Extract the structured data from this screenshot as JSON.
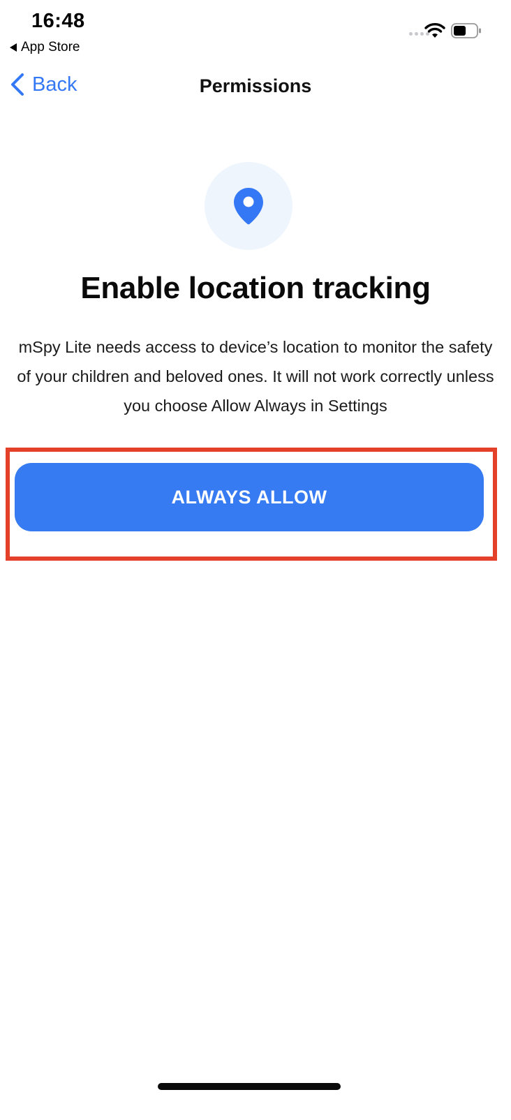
{
  "status_bar": {
    "time": "16:48",
    "back_app_label": "App Store",
    "icons": [
      "cellular-signal-icon",
      "wifi-icon",
      "battery-icon"
    ]
  },
  "nav": {
    "back_label": "Back",
    "title": "Permissions"
  },
  "content": {
    "icon": "location-pin-icon",
    "heading": "Enable location tracking",
    "description": "mSpy Lite needs access to device’s location to monitor the safety of your children and beloved ones. It will not work correctly unless you choose Allow Always in Settings",
    "button_label": "ALWAYS ALLOW"
  },
  "colors": {
    "accent": "#3478f6",
    "button": "#367bf2",
    "icon_bg": "#eef5fd",
    "highlight": "#e4412b"
  }
}
